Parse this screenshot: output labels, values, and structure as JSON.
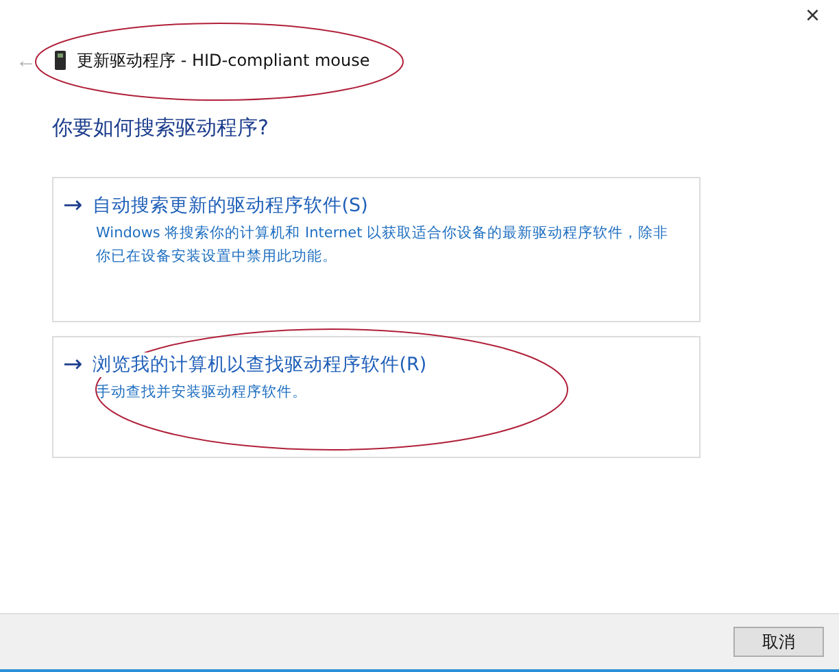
{
  "window": {
    "title": "更新驱动程序 - HID-compliant mouse",
    "close_glyph": "×",
    "back_glyph": "←"
  },
  "heading": "你要如何搜索驱动程序?",
  "options": [
    {
      "arrow": "→",
      "title": "自动搜索更新的驱动程序软件(S)",
      "description": "Windows 将搜索你的计算机和 Internet 以获取适合你设备的最新驱动程序软件，除非你已在设备安装设置中禁用此功能。"
    },
    {
      "arrow": "→",
      "title": "浏览我的计算机以查找驱动程序软件(R)",
      "description": "手动查找并安装驱动程序软件。"
    }
  ],
  "buttons": [
    "取消"
  ]
}
